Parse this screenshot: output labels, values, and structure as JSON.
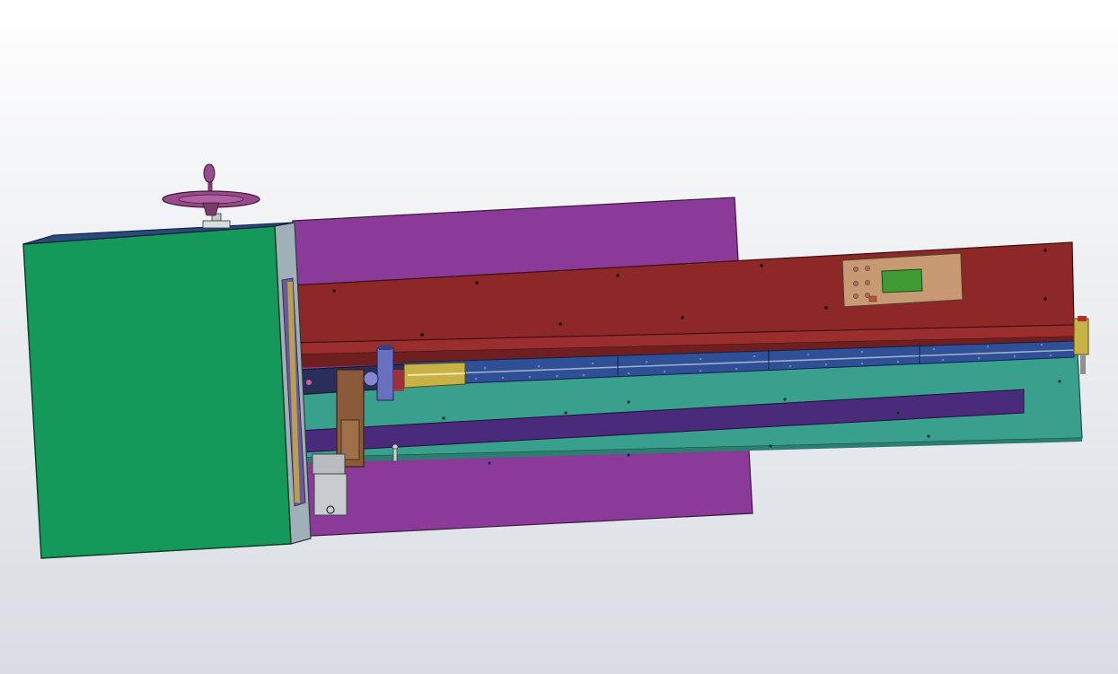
{
  "viewport": {
    "background_top": "#ffffff",
    "background_bottom": "#d9dde3"
  },
  "model": {
    "part_colors": {
      "enclosure": "#14995a",
      "back_plate": "#8c3a99",
      "beam": "#8e2828",
      "base": "#3aa08e",
      "rail": "#2f4f96",
      "cylinder": "#c8b248",
      "handwheel": "#9a4a8c",
      "bar": "#4a2a7a",
      "control_panel": "#c89a74",
      "display": "#3f9a34",
      "motor": "#c9cccf",
      "bracket": "#8a5a3a",
      "frame": "#9fb0b8"
    }
  }
}
